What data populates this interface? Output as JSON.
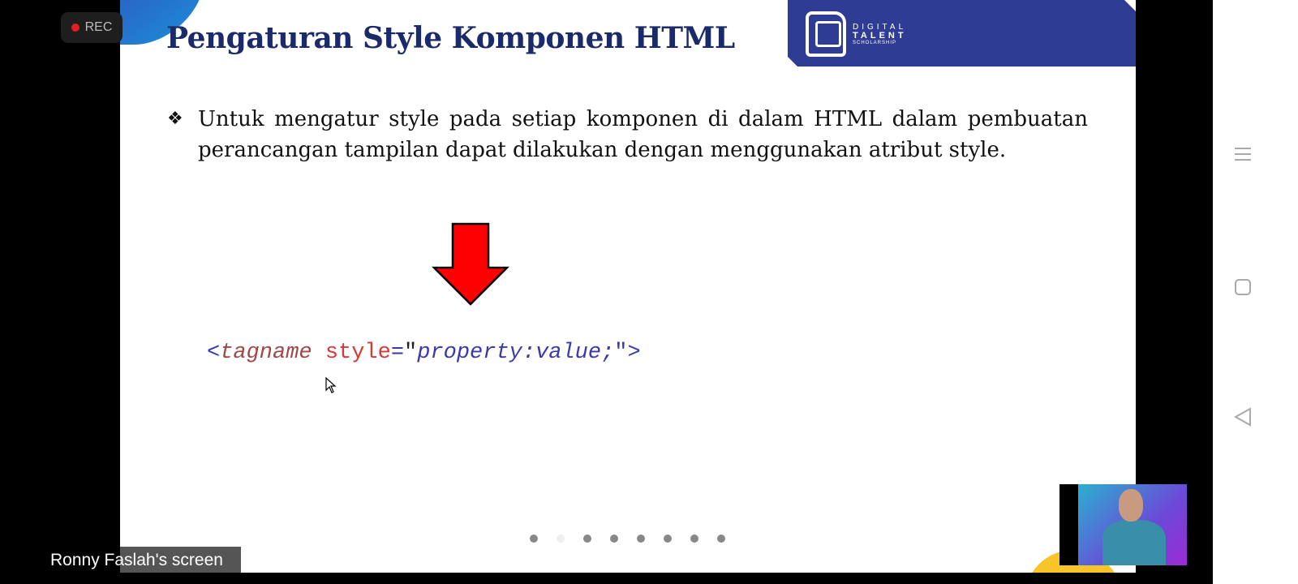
{
  "recording": {
    "label": "REC"
  },
  "slide": {
    "title": "Pengaturan Style Komponen HTML",
    "logo": {
      "line1": "DIGITAL",
      "line2": "TALENT",
      "line3": "SCHOLARSHIP"
    },
    "bullet_symbol": "❖",
    "bullet_text": "Untuk mengatur style pada setiap komponen di dalam HTML dalam pembuatan perancangan tampilan dapat dilakukan dengan menggunakan atribut style.",
    "code": {
      "open": "<",
      "tag": "tagname",
      "attr": "style",
      "eq": "=",
      "q1": "\"",
      "value": "property:value;",
      "close": "\">"
    },
    "pagination": {
      "total": 8,
      "current": 2
    }
  },
  "screen_share_label": "Ronny Faslah's screen",
  "colors": {
    "title": "#1b2a6b",
    "banner": "#2f3c94",
    "arrow": "#ff0000"
  }
}
